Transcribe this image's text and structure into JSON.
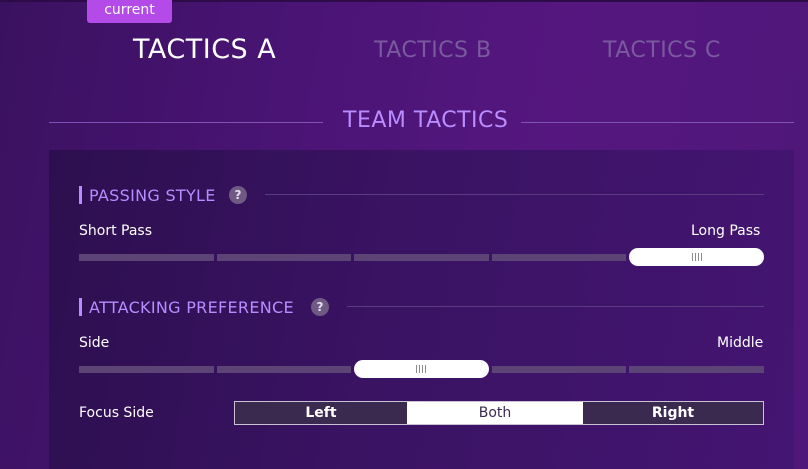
{
  "badge": "current",
  "tabs": [
    {
      "label": "TACTICS A",
      "active": true
    },
    {
      "label": "TACTICS B",
      "active": false
    },
    {
      "label": "TACTICS C",
      "active": false
    }
  ],
  "section_title": "TEAM TACTICS",
  "passing_style": {
    "title": "PASSING STYLE",
    "help": "?",
    "left_label": "Short Pass",
    "right_label": "Long Pass",
    "segments": 5,
    "selected_index": 4
  },
  "attacking_preference": {
    "title": "ATTACKING PREFERENCE",
    "help": "?",
    "left_label": "Side",
    "right_label": "Middle",
    "segments": 5,
    "selected_index": 2
  },
  "focus_side": {
    "label": "Focus Side",
    "options": [
      "Left",
      "Both",
      "Right"
    ],
    "selected": "Both"
  },
  "colors": {
    "accent": "#b98cff",
    "badge": "#b44ae8"
  }
}
